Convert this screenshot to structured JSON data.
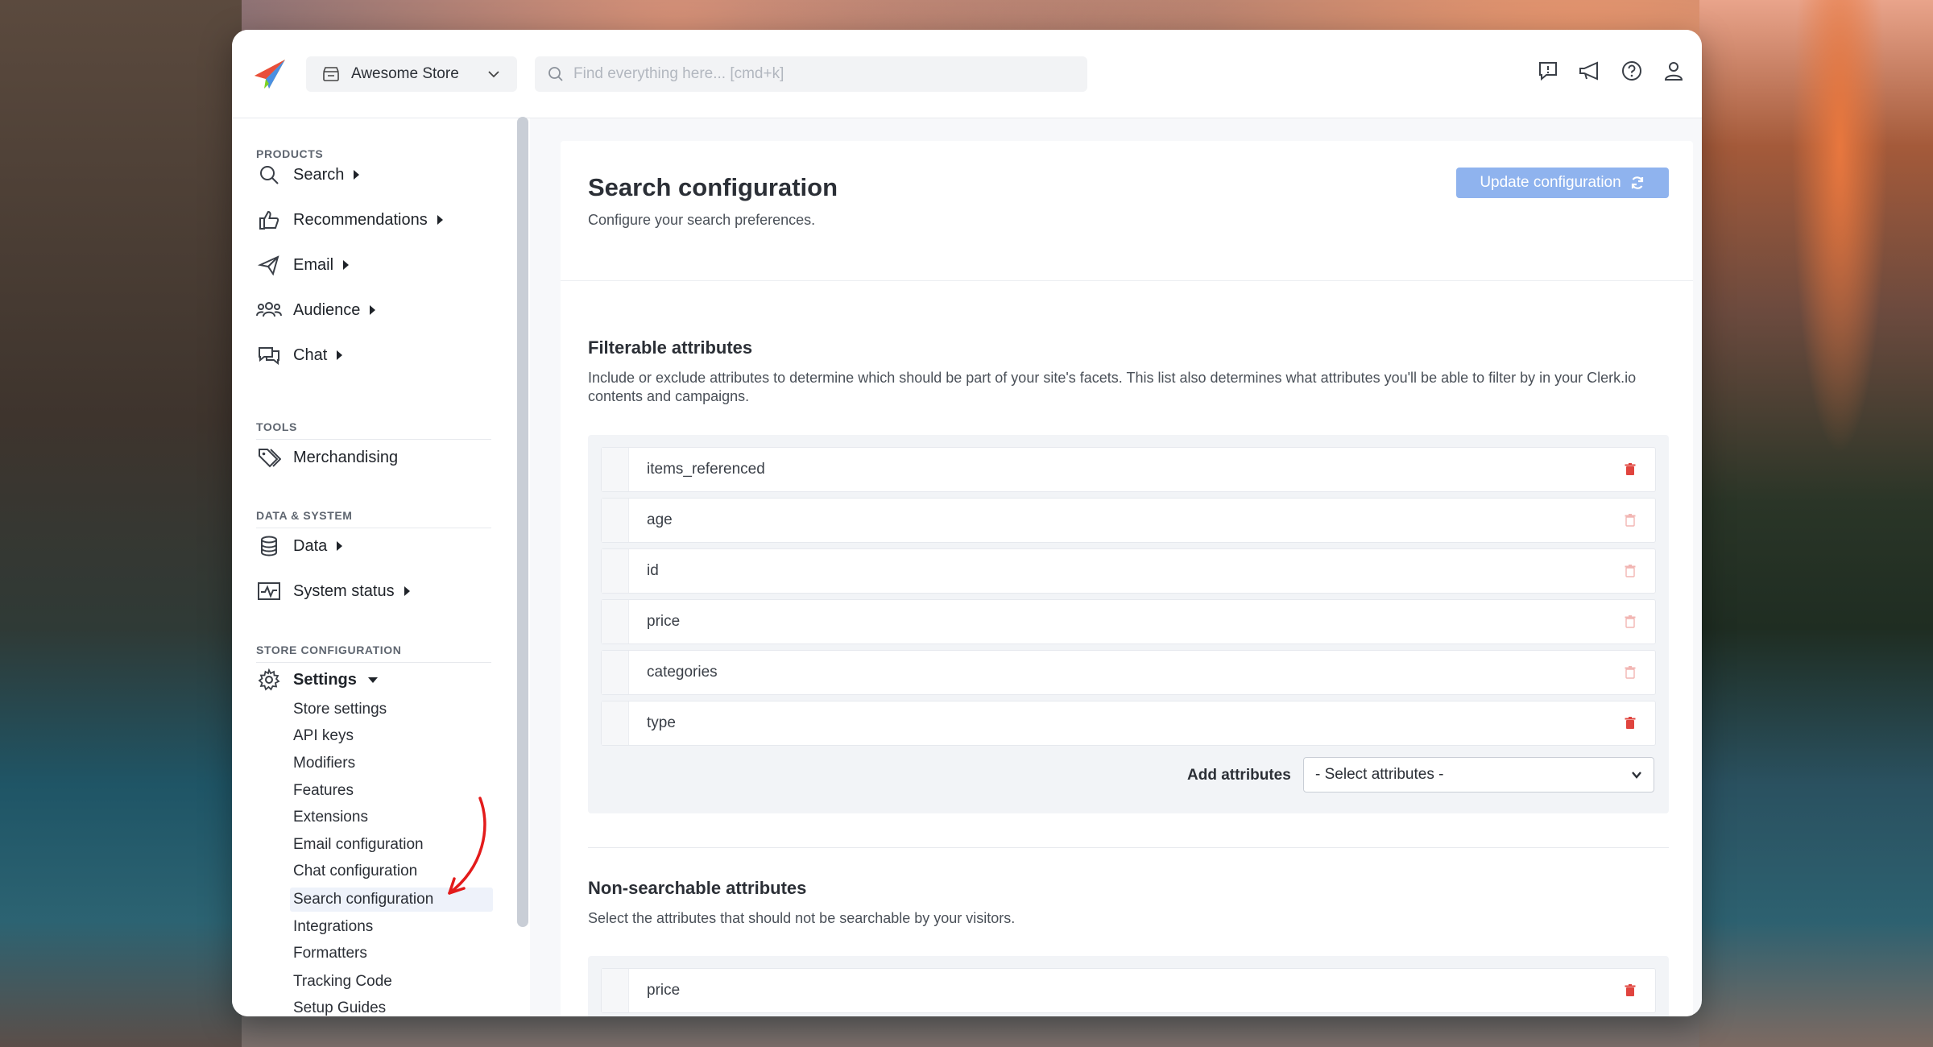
{
  "app": {
    "store_name": "Awesome Store",
    "search_placeholder": "Find everything here... [cmd+k]"
  },
  "top_icons": [
    "feedback-icon",
    "announcement-icon",
    "help-icon",
    "user-icon"
  ],
  "sidebar": {
    "sections": {
      "products": "PRODUCTS",
      "tools": "TOOLS",
      "data_system": "DATA & SYSTEM",
      "store_configuration": "STORE CONFIGURATION"
    },
    "items": {
      "search": "Search",
      "recommendations": "Recommendations",
      "email": "Email",
      "audience": "Audience",
      "chat": "Chat",
      "merchandising": "Merchandising",
      "data": "Data",
      "system_status": "System status",
      "settings": "Settings"
    },
    "settings_children": [
      "Store settings",
      "API keys",
      "Modifiers",
      "Features",
      "Extensions",
      "Email configuration",
      "Chat configuration",
      "Search configuration",
      "Integrations",
      "Formatters",
      "Tracking Code",
      "Setup Guides"
    ],
    "active_child": "Search configuration"
  },
  "main": {
    "title": "Search configuration",
    "subtitle": "Configure your search preferences.",
    "update_button": "Update configuration",
    "filterable": {
      "title": "Filterable attributes",
      "description": "Include or exclude attributes to determine which should be part of your site's facets. This list also determines what attributes you'll be able to filter by in your Clerk.io contents and campaigns.",
      "attributes": [
        {
          "name": "items_referenced",
          "deletable": true
        },
        {
          "name": "age",
          "deletable": false
        },
        {
          "name": "id",
          "deletable": false
        },
        {
          "name": "price",
          "deletable": false
        },
        {
          "name": "categories",
          "deletable": false
        },
        {
          "name": "type",
          "deletable": true
        }
      ],
      "add_label": "Add attributes",
      "select_placeholder": "- Select attributes -"
    },
    "non_searchable": {
      "title": "Non-searchable attributes",
      "description": "Select the attributes that should not be searchable by your visitors.",
      "attributes": [
        {
          "name": "price",
          "deletable": true
        }
      ]
    }
  },
  "colors": {
    "accent_button": "#8fb3ee",
    "trash_active": "#e0443e",
    "trash_disabled": "#f2b6b3",
    "annotation_arrow": "#e31b1b"
  }
}
